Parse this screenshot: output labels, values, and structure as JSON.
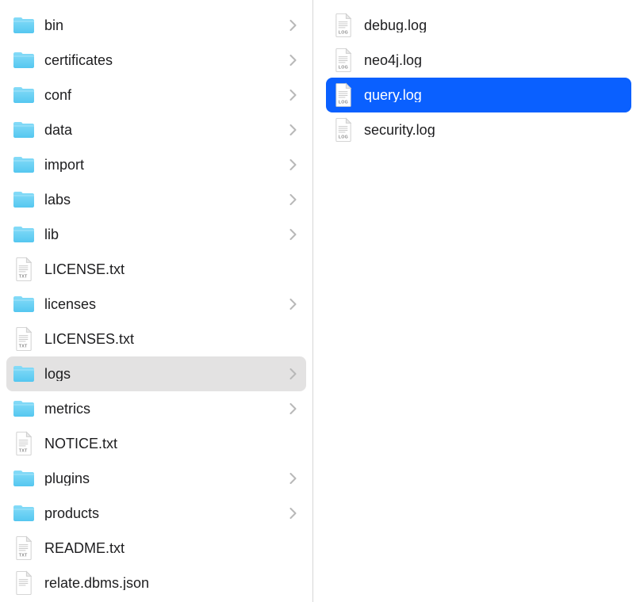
{
  "left_column": {
    "items": [
      {
        "type": "folder",
        "label": "bin",
        "expandable": true
      },
      {
        "type": "folder",
        "label": "certificates",
        "expandable": true
      },
      {
        "type": "folder",
        "label": "conf",
        "expandable": true
      },
      {
        "type": "folder",
        "label": "data",
        "expandable": true
      },
      {
        "type": "folder",
        "label": "import",
        "expandable": true
      },
      {
        "type": "folder",
        "label": "labs",
        "expandable": true
      },
      {
        "type": "folder",
        "label": "lib",
        "expandable": true
      },
      {
        "type": "txt",
        "label": "LICENSE.txt",
        "expandable": false
      },
      {
        "type": "folder",
        "label": "licenses",
        "expandable": true
      },
      {
        "type": "txt",
        "label": "LICENSES.txt",
        "expandable": false
      },
      {
        "type": "folder",
        "label": "logs",
        "expandable": true,
        "active_parent": true
      },
      {
        "type": "folder",
        "label": "metrics",
        "expandable": true
      },
      {
        "type": "txt",
        "label": "NOTICE.txt",
        "expandable": false
      },
      {
        "type": "folder",
        "label": "plugins",
        "expandable": true
      },
      {
        "type": "folder",
        "label": "products",
        "expandable": true
      },
      {
        "type": "txt",
        "label": "README.txt",
        "expandable": false
      },
      {
        "type": "json",
        "label": "relate.dbms.json",
        "expandable": false
      }
    ]
  },
  "right_column": {
    "items": [
      {
        "type": "log",
        "label": "debug.log",
        "selected": false
      },
      {
        "type": "log",
        "label": "neo4j.log",
        "selected": false
      },
      {
        "type": "log",
        "label": "query.log",
        "selected": true
      },
      {
        "type": "log",
        "label": "security.log",
        "selected": false
      }
    ]
  },
  "icon_badges": {
    "txt": "TXT",
    "log": "LOG",
    "json": ""
  }
}
